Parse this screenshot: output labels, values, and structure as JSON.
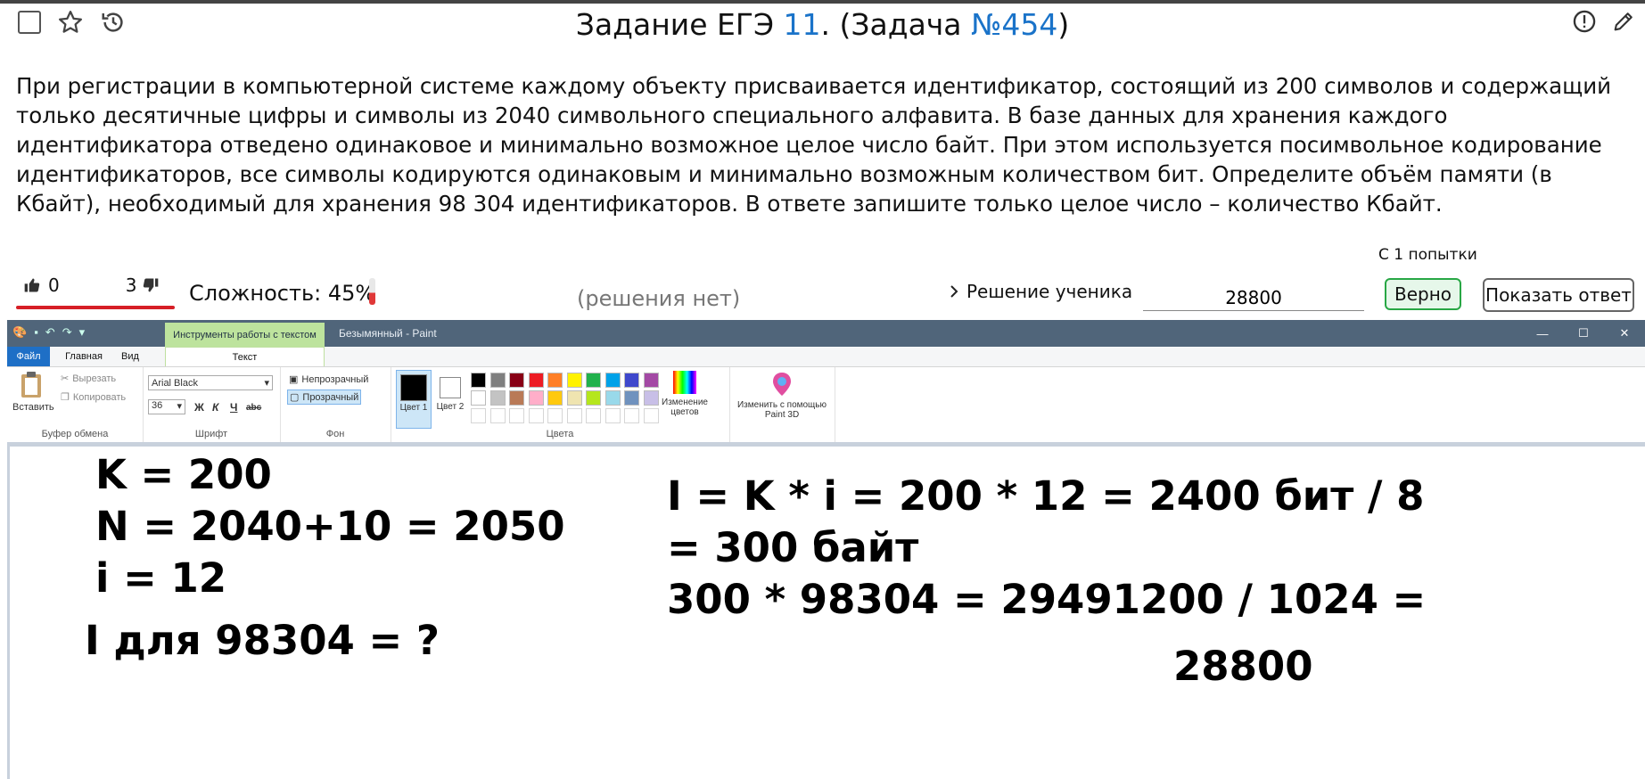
{
  "header": {
    "title_prefix": "Задание ЕГЭ ",
    "task_number": "11",
    "title_mid": ". (Задача ",
    "problem_id": "№454",
    "title_suffix": ")"
  },
  "problem_text": "При регистрации в компьютерной системе каждому объекту присваивается идентификатор, состоящий из 200 символов и содержащий только десятичные цифры и символы из 2040 символьного специального алфавита. В базе данных для хранения каждого идентификатора отведено одинаковое и минимально возможное целое число байт. При этом используется посимвольное кодирование идентификаторов, все символы кодируются одинаковым и минимально возможным количеством бит. Определите объём памяти (в Кбайт), необходимый для хранения 98 304 идентификаторов. В ответе запишите только целое число – количество Кбайт.",
  "rating": {
    "likes": "0",
    "dislikes": "3",
    "difficulty": "Сложность: 45%",
    "difficulty_value": 0.45
  },
  "attempts": "С 1 попытки",
  "no_solutions": "(решения нет)",
  "student_solution": "Решение ученика",
  "answer_value": "28800",
  "btn_correct": "Верно",
  "btn_show": "Показать ответ",
  "paint": {
    "context_tab": "Инструменты работы с текстом",
    "window_title": "Безымянный - Paint",
    "tabs": {
      "file": "Файл",
      "home": "Главная",
      "view": "Вид",
      "text": "Текст"
    },
    "clipboard": {
      "paste": "Вставить",
      "cut": "Вырезать",
      "copy": "Копировать",
      "label": "Буфер обмена"
    },
    "font": {
      "family": "Arial Black",
      "size": "36",
      "bold": "Ж",
      "italic": "К",
      "underline": "Ч",
      "strike": "abc",
      "label": "Шрифт"
    },
    "background": {
      "opaque": "Непрозрачный",
      "transparent": "Прозрачный",
      "label": "Фон"
    },
    "colors": {
      "color1": "Цвет 1",
      "color2": "Цвет 2",
      "edit": "Изменение цветов",
      "label": "Цвета",
      "paint3d": "Изменить с помощью Paint 3D",
      "row1": [
        "#000000",
        "#7f7f7f",
        "#880015",
        "#ed1c24",
        "#ff7f27",
        "#fff200",
        "#22b14c",
        "#00a2e8",
        "#3f48cc",
        "#a349a4"
      ],
      "row2": [
        "#ffffff",
        "#c3c3c3",
        "#b97a57",
        "#ffaec9",
        "#ffc90e",
        "#efe4b0",
        "#b5e61d",
        "#99d9ea",
        "#7092be",
        "#c8bfe7"
      ]
    },
    "canvas": {
      "line1": "K = 200",
      "line2": "N = 2040+10 = 2050",
      "line3": "i = 12",
      "line4": "I для 98304 = ?",
      "line5": "I = K * i = 200 * 12 = 2400 бит / 8",
      "line6": "= 300 байт",
      "line7": "300 * 98304 = 29491200 / 1024 =",
      "line8": "28800"
    }
  }
}
